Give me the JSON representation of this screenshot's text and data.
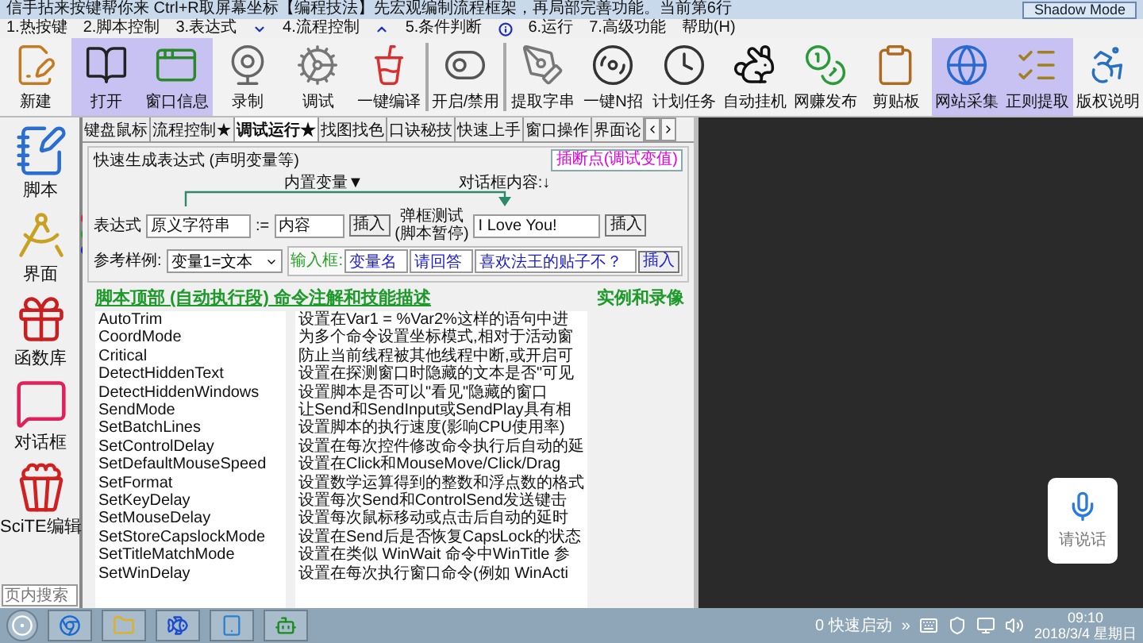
{
  "window": {
    "title": "信手拈来按键帮你来 Ctrl+R取屏幕坐标【编程技法】先宏观编制流程框架，再局部完善功能。当前第6行",
    "mode_button": "Shadow Mode"
  },
  "menu": [
    "1.热按键",
    "2.脚本控制",
    "3.表达式",
    "4.流程控制",
    "5.条件判断",
    "6.运行",
    "7.高级功能",
    "帮助(H)"
  ],
  "toolbar": [
    {
      "label": "新建",
      "highlighted": false
    },
    {
      "label": "打开",
      "highlighted": true
    },
    {
      "label": "窗口信息",
      "highlighted": true
    },
    {
      "label": "录制",
      "highlighted": false
    },
    {
      "label": "调试",
      "highlighted": false
    },
    {
      "label": "一键编译",
      "highlighted": false
    },
    {
      "label": "开启/禁用",
      "highlighted": false
    },
    {
      "label": "提取字串",
      "highlighted": false
    },
    {
      "label": "一键N招",
      "highlighted": false
    },
    {
      "label": "计划任务",
      "highlighted": false
    },
    {
      "label": "自动挂机",
      "highlighted": false
    },
    {
      "label": "网赚发布",
      "highlighted": false
    },
    {
      "label": "剪贴板",
      "highlighted": false
    },
    {
      "label": "网站采集",
      "highlighted": true
    },
    {
      "label": "正则提取",
      "highlighted": true
    },
    {
      "label": "版权说明",
      "highlighted": false
    }
  ],
  "sidebar": {
    "items": [
      {
        "label": "脚本"
      },
      {
        "label": "界面"
      },
      {
        "label": "函数库"
      },
      {
        "label": "对话框"
      },
      {
        "label": "SciTE编辑"
      }
    ],
    "markers": [
      {
        "color": "#e01818"
      },
      {
        "color": "#18a018"
      },
      {
        "color": "#1818e0"
      }
    ],
    "search": {
      "placeholder": "页内搜索"
    }
  },
  "tabs": [
    {
      "label": "键盘鼠标",
      "selected": false
    },
    {
      "label": "流程控制★",
      "selected": false
    },
    {
      "label": "调试运行★",
      "selected": true
    },
    {
      "label": "找图找色",
      "selected": false
    },
    {
      "label": "口诀秘技",
      "selected": false
    },
    {
      "label": "快速上手",
      "selected": false
    },
    {
      "label": "窗口操作",
      "selected": false
    },
    {
      "label": "界面论",
      "selected": false
    }
  ],
  "expression_panel": {
    "title": "快速生成表达式 (声明变量等)",
    "breakpoint_button": "插断点(调试变值)",
    "builtin_vars": "内置变量▼",
    "dialog_content_label": "对话框内容:↓",
    "expression_label": "表达式",
    "var_name": "原义字符串",
    "assign": ":=",
    "value": "内容",
    "insert": "插入",
    "popup_test": "弹框测试",
    "popup_note": "(脚本暂停)",
    "dialog_text": "I Love You!",
    "dialog_insert": "插入",
    "example_label": "参考样例:",
    "example_value": "变量1=文本",
    "input_box": {
      "label": "输入框:",
      "var": "变量名",
      "prompt": "请回答",
      "question": "喜欢法王的贴子不？",
      "insert": "插入"
    }
  },
  "commands_heading": "脚本顶部 (自动执行段) 命令注解和技能描述",
  "examples_link": "实例和录像",
  "commands": [
    {
      "name": "AutoTrim",
      "description": "设置在Var1 = %Var2%这样的语句中进"
    },
    {
      "name": "CoordMode",
      "description": "为多个命令设置坐标模式,相对于活动窗"
    },
    {
      "name": "Critical",
      "description": "防止当前线程被其他线程中断,或开启可"
    },
    {
      "name": "DetectHiddenText",
      "description": "设置在探测窗口时隐藏的文本是否\"可见"
    },
    {
      "name": "DetectHiddenWindows",
      "description": "设置脚本是否可以\"看见\"隐藏的窗口"
    },
    {
      "name": "SendMode",
      "description": "让Send和SendInput或SendPlay具有相"
    },
    {
      "name": "SetBatchLines",
      "description": "设置脚本的执行速度(影响CPU使用率)"
    },
    {
      "name": "SetControlDelay",
      "description": "设置在每次控件修改命令执行后自动的延"
    },
    {
      "name": "SetDefaultMouseSpeed",
      "description": "设置在Click和MouseMove/Click/Drag"
    },
    {
      "name": "SetFormat",
      "description": "设置数学运算得到的整数和浮点数的格式"
    },
    {
      "name": "SetKeyDelay",
      "description": "设置每次Send和ControlSend发送键击"
    },
    {
      "name": "SetMouseDelay",
      "description": "设置每次鼠标移动或点击后自动的延时"
    },
    {
      "name": "SetStoreCapslockMode",
      "description": "设置在Send后是否恢复CapsLock的状态"
    },
    {
      "name": "SetTitleMatchMode",
      "description": "设置在类似 WinWait 命令中WinTitle 参"
    },
    {
      "name": "SetWinDelay",
      "description": "设置在每次执行窗口命令(例如 WinActi"
    }
  ],
  "voice": {
    "label": "请说话"
  },
  "taskbar": {
    "quick_launch": "0 快速启动",
    "expand": "»",
    "time": "09:10",
    "date": "2018/3/4 星期日"
  }
}
